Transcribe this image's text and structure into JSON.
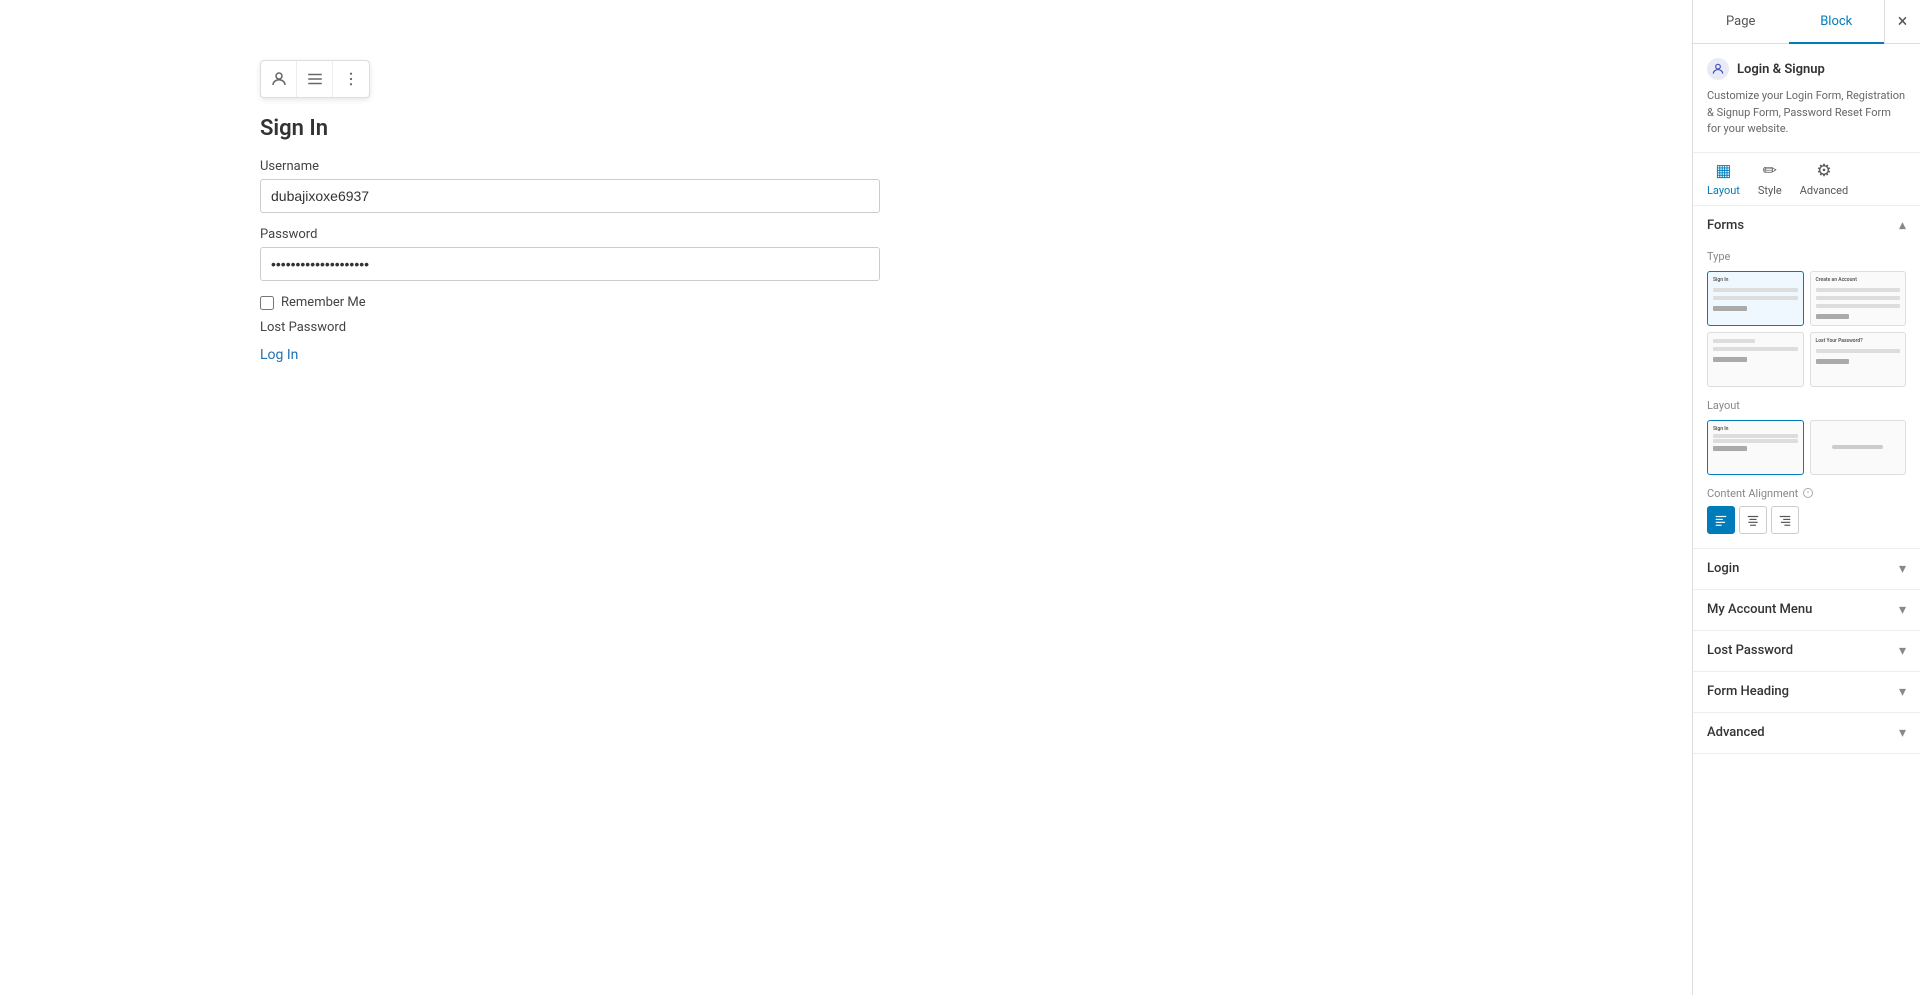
{
  "panel": {
    "tabs": [
      "Page",
      "Block"
    ],
    "active_tab": "Block",
    "close_label": "×"
  },
  "plugin": {
    "name": "Login & Signup",
    "description": "Customize your Login Form, Registration & Signup Form, Password Reset Form for your website."
  },
  "tabs": [
    {
      "id": "layout",
      "label": "Layout",
      "icon": "▦",
      "active": true
    },
    {
      "id": "style",
      "label": "Style",
      "icon": "✏",
      "active": false
    },
    {
      "id": "advanced",
      "label": "Advanced",
      "icon": "⚙",
      "active": false
    }
  ],
  "forms_section": {
    "label": "Forms",
    "type_label": "Type",
    "layout_label": "Layout",
    "content_alignment_label": "Content Alignment",
    "alignment_options": [
      "left",
      "center",
      "right"
    ],
    "active_alignment": "left"
  },
  "accordion_sections": [
    {
      "id": "login",
      "label": "Login",
      "open": false
    },
    {
      "id": "my-account-menu",
      "label": "My Account Menu",
      "open": false
    },
    {
      "id": "lost-password",
      "label": "Lost Password",
      "open": false
    },
    {
      "id": "form-heading",
      "label": "Form Heading",
      "open": false
    },
    {
      "id": "advanced",
      "label": "Advanced",
      "open": false
    }
  ],
  "form": {
    "title": "Sign In",
    "username_label": "Username",
    "username_value": "dubajixoxe6937",
    "password_label": "Password",
    "password_value": "••••••••••••••••••••",
    "remember_me_label": "Remember Me",
    "lost_password_text": "Lost Password",
    "login_link_text": "Log In"
  },
  "toolbar": {
    "user_icon": "👤",
    "list_icon": "☰",
    "more_icon": "⋮"
  }
}
